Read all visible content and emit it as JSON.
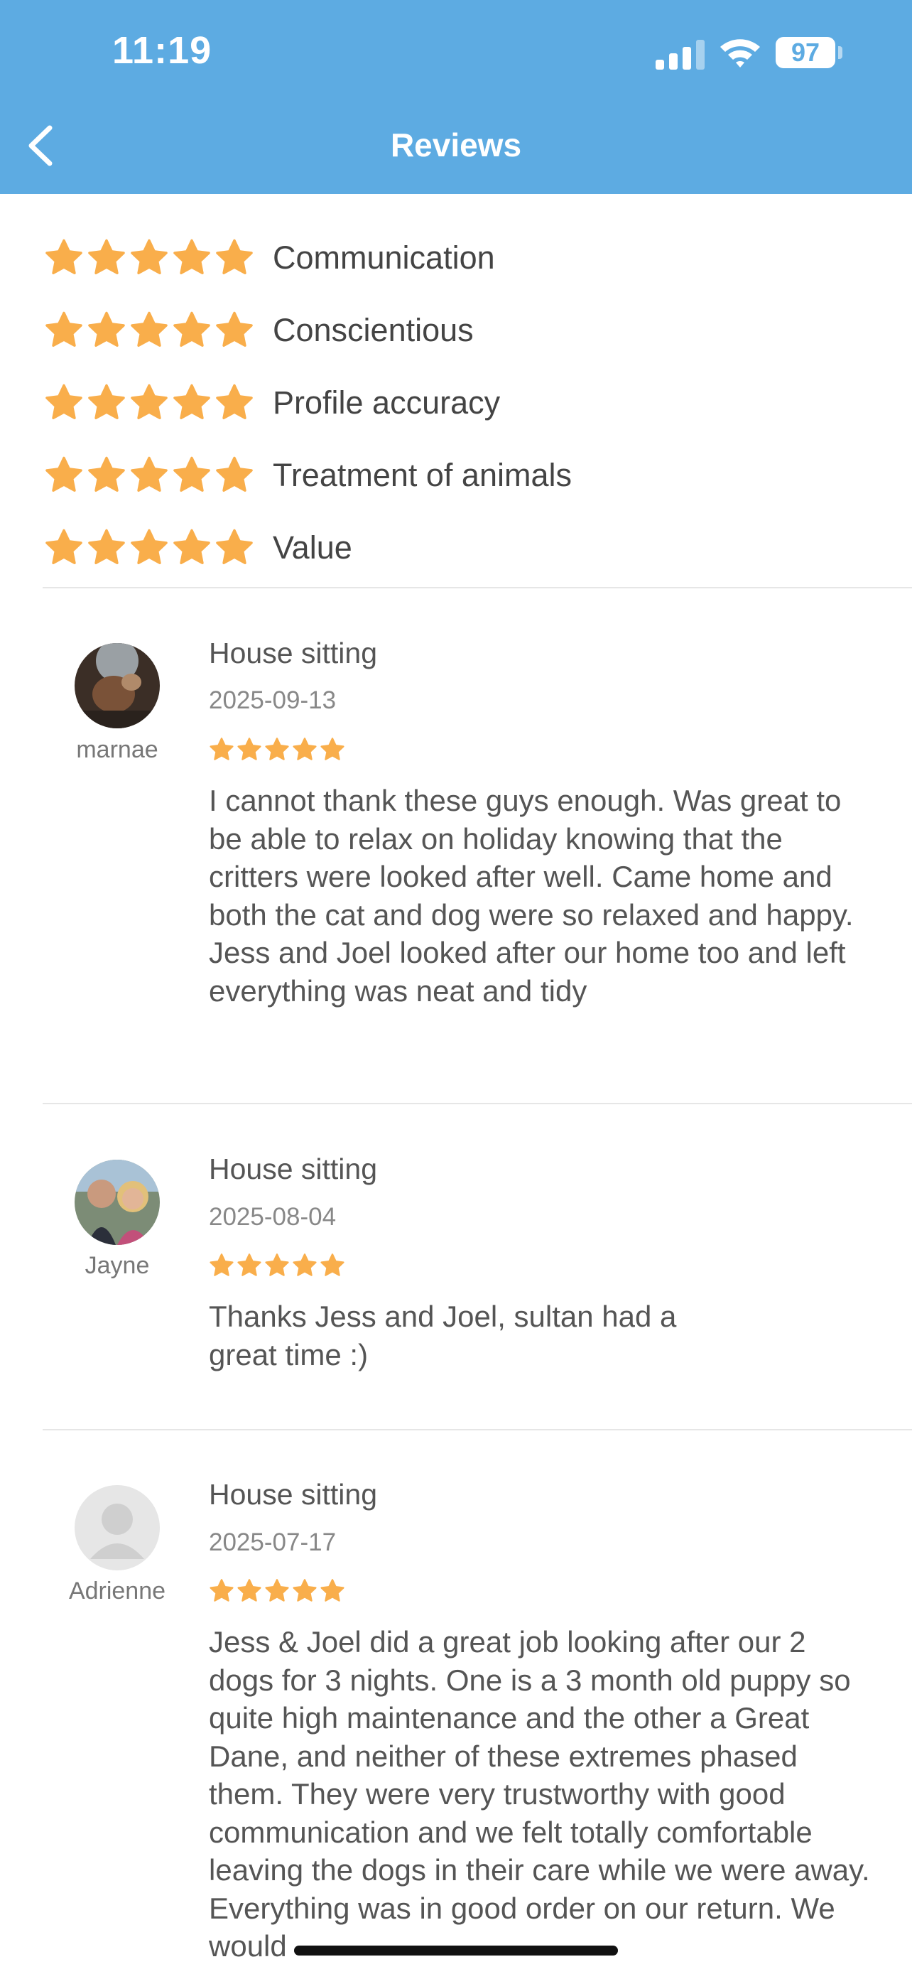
{
  "status_bar": {
    "time": "11:19",
    "battery": "97",
    "icons": [
      "cellular-signal-icon",
      "wifi-icon",
      "battery-icon"
    ]
  },
  "nav": {
    "title": "Reviews",
    "back_icon": "chevron-left-icon"
  },
  "colors": {
    "header": "#5dabe2",
    "star": "#f9ae4b",
    "text": "#555555"
  },
  "summary": [
    {
      "label": "Communication",
      "stars": 5
    },
    {
      "label": "Conscientious",
      "stars": 5
    },
    {
      "label": "Profile accuracy",
      "stars": 5
    },
    {
      "label": "Treatment of animals",
      "stars": 5
    },
    {
      "label": "Value",
      "stars": 5
    }
  ],
  "reviews": [
    {
      "name": "marnae",
      "service": "House sitting",
      "date": "2025-09-13",
      "stars": 5,
      "text": "I cannot thank these guys enough. Was great to be able to relax on holiday knowing that the critters were looked after well. Came home and both the cat and dog were so relaxed and happy. Jess and Joel looked after our home too and left everything was neat and tidy"
    },
    {
      "name": "Jayne",
      "service": "House sitting",
      "date": "2025-08-04",
      "stars": 5,
      "text": "Thanks Jess and Joel, sultan had a great time :)"
    },
    {
      "name": "Adrienne",
      "service": "House sitting",
      "date": "2025-07-17",
      "stars": 5,
      "text": "Jess & Joel did a great job looking after our 2 dogs for 3 nights. One is a 3 month old puppy so quite high maintenance and the other a Great Dane, and neither of these extremes phased them. They were very trustworthy with good communication and we felt totally comfortable leaving the dogs in their care while we were away. Everything was in good order on our return. We would"
    }
  ]
}
